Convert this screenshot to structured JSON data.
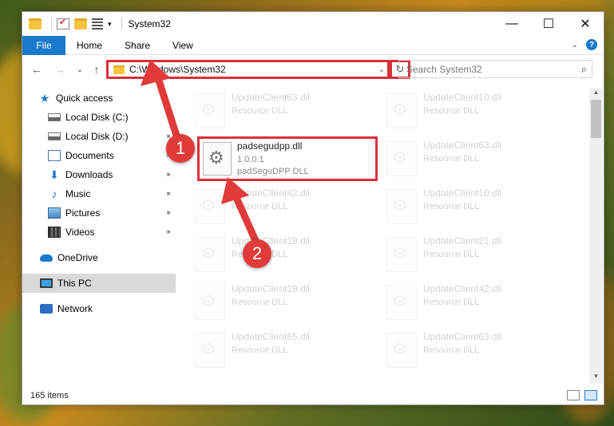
{
  "window": {
    "title": "System32"
  },
  "window_controls": {
    "minimize": "—",
    "maximize": "☐",
    "close": "✕"
  },
  "ribbon": {
    "file": "File",
    "tabs": [
      "Home",
      "Share",
      "View"
    ],
    "help": "?",
    "expand": "⌄"
  },
  "nav": {
    "back": "←",
    "forward": "→",
    "recent": "⌄",
    "up": "↑",
    "address": "C:\\Windows\\System32",
    "address_dropdown": "⌄",
    "refresh": "↻",
    "search_placeholder": "Search System32",
    "search_icon": "⌕"
  },
  "sidebar": {
    "items": [
      {
        "label": "Quick access",
        "icon": "star-icon"
      },
      {
        "label": "Local Disk (C:)",
        "icon": "drive-icon",
        "pinned": true
      },
      {
        "label": "Local Disk (D:)",
        "icon": "drive-icon",
        "pinned": true
      },
      {
        "label": "Documents",
        "icon": "documents-icon",
        "pinned": true
      },
      {
        "label": "Downloads",
        "icon": "downloads-icon",
        "pinned": true
      },
      {
        "label": "Music",
        "icon": "music-icon",
        "pinned": true
      },
      {
        "label": "Pictures",
        "icon": "pictures-icon",
        "pinned": true
      },
      {
        "label": "Videos",
        "icon": "videos-icon",
        "pinned": true
      },
      {
        "label": "OneDrive",
        "icon": "onedrive-icon"
      },
      {
        "label": "This PC",
        "icon": "this-pc-icon",
        "selected": true
      },
      {
        "label": "Network",
        "icon": "network-icon"
      }
    ],
    "pin_glyph": "📌"
  },
  "files": {
    "left_column": [
      {
        "name": "UpdateClient63.dll",
        "type": "Resource DLL"
      },
      {
        "name": "padsegudpp.dll",
        "version": "1.0.0.1",
        "description": "padSeguDPP DLL",
        "highlighted": true
      },
      {
        "name": "UpdateClient42.dll",
        "type": "Resource DLL"
      },
      {
        "name": "UpdateClient19.dll",
        "type": "Resource DLL"
      },
      {
        "name": "UpdateClient19.dll",
        "type": "Resource DLL"
      },
      {
        "name": "UpdateClient65.dll",
        "type": "Resource DLL"
      }
    ],
    "right_column": [
      {
        "name": "UpdateClient10.dll",
        "type": "Resource DLL"
      },
      {
        "name": "UpdateClient63.dll",
        "type": "Resource DLL"
      },
      {
        "name": "UpdateClient10.dll",
        "type": "Resource DLL"
      },
      {
        "name": "UpdateClient21.dll",
        "type": "Resource DLL"
      },
      {
        "name": "UpdateClient42.dll",
        "type": "Resource DLL"
      },
      {
        "name": "UpdateClient63.dll",
        "type": "Resource DLL"
      }
    ]
  },
  "status": {
    "item_count": "165 items"
  },
  "annotations": {
    "step1": "1",
    "step2": "2"
  },
  "colors": {
    "accent": "#1979ca",
    "annotation_red": "#d9303a",
    "selected_bg": "#d9d9d9"
  }
}
